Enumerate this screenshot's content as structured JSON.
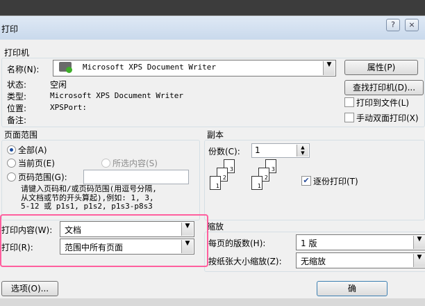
{
  "window": {
    "title": "打印",
    "help_glyph": "?",
    "close_glyph": "×"
  },
  "printer": {
    "group_label": "打印机",
    "name_label": "名称(N):",
    "name_value": "Microsoft XPS Document Writer",
    "status_label": "状态:",
    "status_value": "空闲",
    "type_label": "类型:",
    "type_value": "Microsoft XPS Document Writer",
    "where_label": "位置:",
    "where_value": "XPSPort:",
    "comment_label": "备注:",
    "properties_button": "属性(P)",
    "find_button": "查找打印机(D)...",
    "print_to_file": "打印到文件(L)",
    "print_to_file_checked": false,
    "manual_duplex": "手动双面打印(X)",
    "manual_duplex_checked": false
  },
  "page_range": {
    "group_label": "页面范围",
    "all": "全部(A)",
    "current": "当前页(E)",
    "selection": "所选内容(S)",
    "pages": "页码范围(G):",
    "selected": "all",
    "pages_value": "",
    "hint": "请键入页码和/或页码范围(用逗号分隔,\n从文档或节的开头算起),例如: 1, 3,\n5-12 或 p1s1, p1s2, p1s3-p8s3"
  },
  "copies": {
    "group_label": "副本",
    "count_label": "份数(C):",
    "count_value": "1",
    "collate_label": "逐份打印(T)",
    "collate_checked": true,
    "pages_stack_a": [
      "3",
      "2",
      "1"
    ],
    "pages_stack_b": [
      "3",
      "2",
      "1"
    ]
  },
  "print_what": {
    "label": "打印内容(W):",
    "value": "文档"
  },
  "print_scope": {
    "label": "打印(R):",
    "value": "范围中所有页面"
  },
  "zoom": {
    "group_label": "缩放",
    "pages_per_sheet_label": "每页的版数(H):",
    "pages_per_sheet_value": "1 版",
    "scale_label": "按纸张大小缩放(Z):",
    "scale_value": "无缩放"
  },
  "footer": {
    "options_button": "选项(O)...",
    "ok_button": "确"
  },
  "colors": {
    "highlight": "#ff5f9e",
    "title_bar": "#c9d9ec"
  }
}
